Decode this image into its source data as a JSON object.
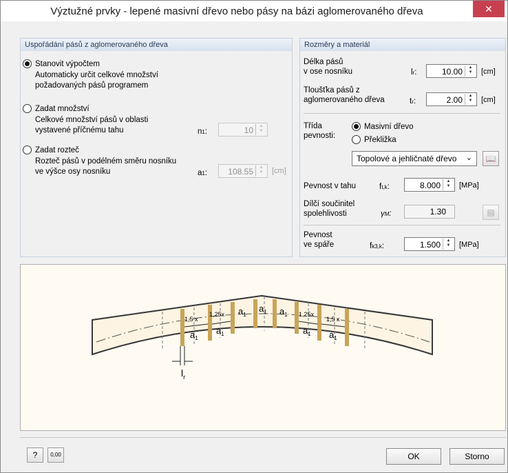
{
  "window": {
    "title": "Výztužné prvky - lepené masivní dřevo nebo pásy na bázi aglomerovaného dřeva",
    "close_glyph": "✕"
  },
  "left": {
    "header": "Uspořádání pásů z aglomerovaného dřeva",
    "opt1": {
      "label": "Stanovit výpočtem",
      "desc1": "Automaticky určit celkové množství",
      "desc2": "požadovaných pásů programem"
    },
    "opt2": {
      "label": "Zadat množství",
      "desc1": "Celkové množství pásů v oblasti",
      "desc2": "vystavené příčnému tahu",
      "sym": "n",
      "sym_sub": "1",
      "value": "10"
    },
    "opt3": {
      "label": "Zadat rozteč",
      "desc1": "Rozteč pásů v podélném směru nosníku",
      "desc2": "ve výšce osy nosníku",
      "sym": "a",
      "sym_sub": "1",
      "value": "108.55",
      "unit": "[cm]"
    }
  },
  "right": {
    "header": "Rozměry a materiál",
    "len": {
      "l1": "Délka pásů",
      "l2": "v ose nosníku",
      "sym": "l",
      "sym_sub": "r",
      "value": "10.00",
      "unit": "[cm]"
    },
    "thk": {
      "l1": "Tloušťka pásů z",
      "l2": "aglomerovaného dřeva",
      "sym": "t",
      "sym_sub": "r",
      "value": "2.00",
      "unit": "[cm]"
    },
    "cls": {
      "l1": "Třída",
      "l2": "pevnosti:",
      "opt_a": "Masivní dřevo",
      "opt_b": "Překližka",
      "select": "Topolové a jehličnaté dřevo"
    },
    "ft": {
      "label": "Pevnost v tahu",
      "sym": "f",
      "sym_sub": "t,k",
      "value": "8.000",
      "unit": "[MPa]"
    },
    "gm": {
      "l1": "Dílčí součinitel",
      "l2": "spolehlivosti",
      "sym": "γ",
      "sym_sub": "M",
      "value": "1.30"
    },
    "fk": {
      "l1": "Pevnost",
      "l2": "ve spáře",
      "sym": "f",
      "sym_sub": "k3,k",
      "value": "1.500",
      "unit": "[MPa]"
    }
  },
  "diagram": {
    "labels_top": [
      "1,5 x",
      "1,25x",
      "a",
      "a",
      "a",
      "1,25x",
      "1,5 x"
    ],
    "labels_bottom": [
      "a",
      "a",
      "a",
      "a"
    ],
    "sub": "1",
    "lr_label": "l",
    "lr_sub": "r",
    "colors": {
      "beam": "#fdf4e3",
      "strip": "#c9a458",
      "line": "#3a3a3a"
    }
  },
  "footer": {
    "help_glyph": "?",
    "units_glyph": "0,00",
    "ok": "OK",
    "cancel": "Storno"
  }
}
